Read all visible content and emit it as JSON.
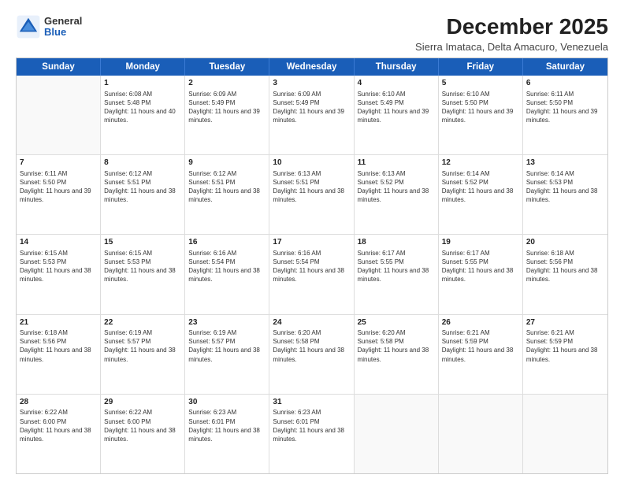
{
  "logo": {
    "general": "General",
    "blue": "Blue"
  },
  "title": "December 2025",
  "subtitle": "Sierra Imataca, Delta Amacuro, Venezuela",
  "header_days": [
    "Sunday",
    "Monday",
    "Tuesday",
    "Wednesday",
    "Thursday",
    "Friday",
    "Saturday"
  ],
  "weeks": [
    [
      {
        "day": "",
        "empty": true
      },
      {
        "day": "1",
        "sunrise": "6:08 AM",
        "sunset": "5:48 PM",
        "daylight": "11 hours and 40 minutes."
      },
      {
        "day": "2",
        "sunrise": "6:09 AM",
        "sunset": "5:49 PM",
        "daylight": "11 hours and 39 minutes."
      },
      {
        "day": "3",
        "sunrise": "6:09 AM",
        "sunset": "5:49 PM",
        "daylight": "11 hours and 39 minutes."
      },
      {
        "day": "4",
        "sunrise": "6:10 AM",
        "sunset": "5:49 PM",
        "daylight": "11 hours and 39 minutes."
      },
      {
        "day": "5",
        "sunrise": "6:10 AM",
        "sunset": "5:50 PM",
        "daylight": "11 hours and 39 minutes."
      },
      {
        "day": "6",
        "sunrise": "6:11 AM",
        "sunset": "5:50 PM",
        "daylight": "11 hours and 39 minutes."
      }
    ],
    [
      {
        "day": "7",
        "sunrise": "6:11 AM",
        "sunset": "5:50 PM",
        "daylight": "11 hours and 39 minutes."
      },
      {
        "day": "8",
        "sunrise": "6:12 AM",
        "sunset": "5:51 PM",
        "daylight": "11 hours and 38 minutes."
      },
      {
        "day": "9",
        "sunrise": "6:12 AM",
        "sunset": "5:51 PM",
        "daylight": "11 hours and 38 minutes."
      },
      {
        "day": "10",
        "sunrise": "6:13 AM",
        "sunset": "5:51 PM",
        "daylight": "11 hours and 38 minutes."
      },
      {
        "day": "11",
        "sunrise": "6:13 AM",
        "sunset": "5:52 PM",
        "daylight": "11 hours and 38 minutes."
      },
      {
        "day": "12",
        "sunrise": "6:14 AM",
        "sunset": "5:52 PM",
        "daylight": "11 hours and 38 minutes."
      },
      {
        "day": "13",
        "sunrise": "6:14 AM",
        "sunset": "5:53 PM",
        "daylight": "11 hours and 38 minutes."
      }
    ],
    [
      {
        "day": "14",
        "sunrise": "6:15 AM",
        "sunset": "5:53 PM",
        "daylight": "11 hours and 38 minutes."
      },
      {
        "day": "15",
        "sunrise": "6:15 AM",
        "sunset": "5:53 PM",
        "daylight": "11 hours and 38 minutes."
      },
      {
        "day": "16",
        "sunrise": "6:16 AM",
        "sunset": "5:54 PM",
        "daylight": "11 hours and 38 minutes."
      },
      {
        "day": "17",
        "sunrise": "6:16 AM",
        "sunset": "5:54 PM",
        "daylight": "11 hours and 38 minutes."
      },
      {
        "day": "18",
        "sunrise": "6:17 AM",
        "sunset": "5:55 PM",
        "daylight": "11 hours and 38 minutes."
      },
      {
        "day": "19",
        "sunrise": "6:17 AM",
        "sunset": "5:55 PM",
        "daylight": "11 hours and 38 minutes."
      },
      {
        "day": "20",
        "sunrise": "6:18 AM",
        "sunset": "5:56 PM",
        "daylight": "11 hours and 38 minutes."
      }
    ],
    [
      {
        "day": "21",
        "sunrise": "6:18 AM",
        "sunset": "5:56 PM",
        "daylight": "11 hours and 38 minutes."
      },
      {
        "day": "22",
        "sunrise": "6:19 AM",
        "sunset": "5:57 PM",
        "daylight": "11 hours and 38 minutes."
      },
      {
        "day": "23",
        "sunrise": "6:19 AM",
        "sunset": "5:57 PM",
        "daylight": "11 hours and 38 minutes."
      },
      {
        "day": "24",
        "sunrise": "6:20 AM",
        "sunset": "5:58 PM",
        "daylight": "11 hours and 38 minutes."
      },
      {
        "day": "25",
        "sunrise": "6:20 AM",
        "sunset": "5:58 PM",
        "daylight": "11 hours and 38 minutes."
      },
      {
        "day": "26",
        "sunrise": "6:21 AM",
        "sunset": "5:59 PM",
        "daylight": "11 hours and 38 minutes."
      },
      {
        "day": "27",
        "sunrise": "6:21 AM",
        "sunset": "5:59 PM",
        "daylight": "11 hours and 38 minutes."
      }
    ],
    [
      {
        "day": "28",
        "sunrise": "6:22 AM",
        "sunset": "6:00 PM",
        "daylight": "11 hours and 38 minutes."
      },
      {
        "day": "29",
        "sunrise": "6:22 AM",
        "sunset": "6:00 PM",
        "daylight": "11 hours and 38 minutes."
      },
      {
        "day": "30",
        "sunrise": "6:23 AM",
        "sunset": "6:01 PM",
        "daylight": "11 hours and 38 minutes."
      },
      {
        "day": "31",
        "sunrise": "6:23 AM",
        "sunset": "6:01 PM",
        "daylight": "11 hours and 38 minutes."
      },
      {
        "day": "",
        "empty": true
      },
      {
        "day": "",
        "empty": true
      },
      {
        "day": "",
        "empty": true
      }
    ]
  ]
}
